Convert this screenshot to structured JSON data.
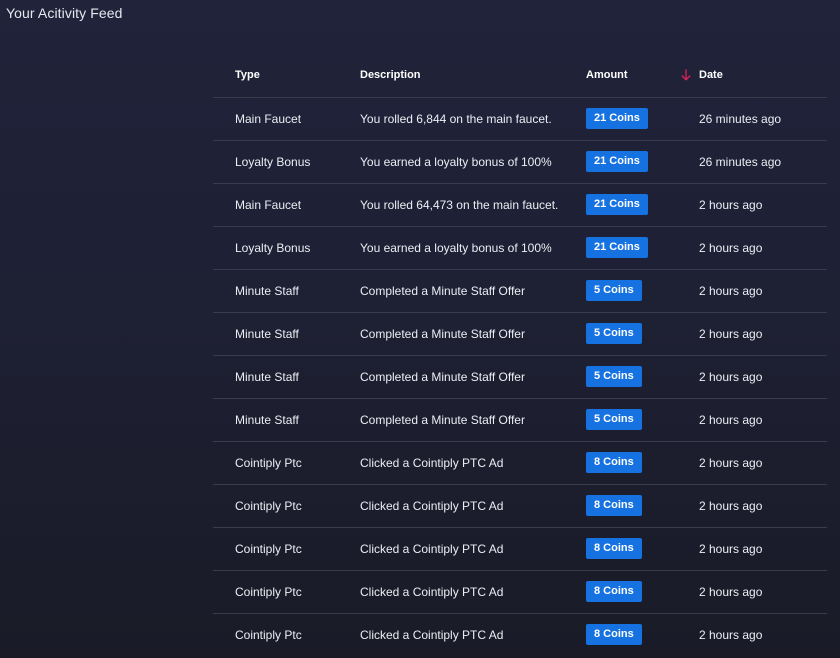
{
  "page": {
    "title": "Your Acitivity Feed"
  },
  "table": {
    "headers": {
      "type": "Type",
      "description": "Description",
      "amount": "Amount",
      "date": "Date"
    },
    "sort_icon": "arrow-down-icon",
    "rows": [
      {
        "type": "Main Faucet",
        "description": "You rolled 6,844 on the main faucet.",
        "amount": "21 Coins",
        "date": "26 minutes ago"
      },
      {
        "type": "Loyalty Bonus",
        "description": "You earned a loyalty bonus of 100%",
        "amount": "21 Coins",
        "date": "26 minutes ago"
      },
      {
        "type": "Main Faucet",
        "description": "You rolled 64,473 on the main faucet.",
        "amount": "21 Coins",
        "date": "2 hours ago"
      },
      {
        "type": "Loyalty Bonus",
        "description": "You earned a loyalty bonus of 100%",
        "amount": "21 Coins",
        "date": "2 hours ago"
      },
      {
        "type": "Minute Staff",
        "description": "Completed a Minute Staff Offer",
        "amount": "5 Coins",
        "date": "2 hours ago"
      },
      {
        "type": "Minute Staff",
        "description": "Completed a Minute Staff Offer",
        "amount": "5 Coins",
        "date": "2 hours ago"
      },
      {
        "type": "Minute Staff",
        "description": "Completed a Minute Staff Offer",
        "amount": "5 Coins",
        "date": "2 hours ago"
      },
      {
        "type": "Minute Staff",
        "description": "Completed a Minute Staff Offer",
        "amount": "5 Coins",
        "date": "2 hours ago"
      },
      {
        "type": "Cointiply Ptc",
        "description": "Clicked a Cointiply PTC Ad",
        "amount": "8 Coins",
        "date": "2 hours ago"
      },
      {
        "type": "Cointiply Ptc",
        "description": "Clicked a Cointiply PTC Ad",
        "amount": "8 Coins",
        "date": "2 hours ago"
      },
      {
        "type": "Cointiply Ptc",
        "description": "Clicked a Cointiply PTC Ad",
        "amount": "8 Coins",
        "date": "2 hours ago"
      },
      {
        "type": "Cointiply Ptc",
        "description": "Clicked a Cointiply PTC Ad",
        "amount": "8 Coins",
        "date": "2 hours ago"
      },
      {
        "type": "Cointiply Ptc",
        "description": "Clicked a Cointiply PTC Ad",
        "amount": "8 Coins",
        "date": "2 hours ago"
      }
    ]
  },
  "colors": {
    "badge": "#1672e0",
    "sort_arrow": "#e2205a",
    "row_divider": "#3a3c4d"
  }
}
